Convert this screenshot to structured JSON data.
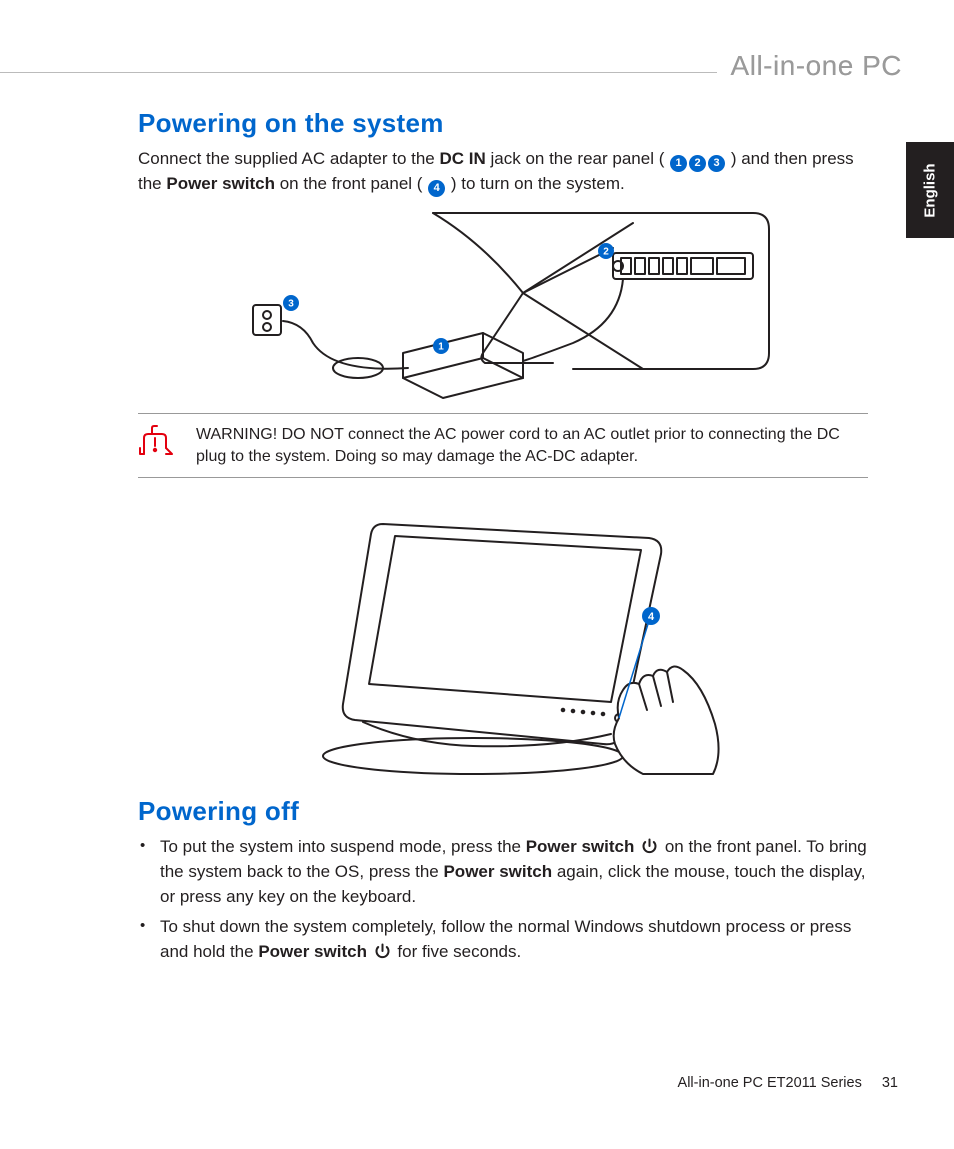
{
  "brand": "All-in-one PC",
  "language_tab": "English",
  "section1": {
    "heading": "Powering on the system",
    "para_pre": "Connect the supplied AC adapter to the ",
    "bold_dcin": "DC IN",
    "para_mid1": " jack on the rear panel ( ",
    "callouts_a": [
      "1",
      "2",
      "3"
    ],
    "para_mid2": " ) and then press the ",
    "bold_power": "Power switch",
    "para_mid3": " on the front panel ( ",
    "callouts_b": [
      "4"
    ],
    "para_end": " ) to turn on the system."
  },
  "figure1_callouts": {
    "c1": "1",
    "c2": "2",
    "c3": "3"
  },
  "figure2_callout": "4",
  "warning": {
    "text": "WARNING! DO NOT connect the AC power cord to an AC outlet prior to connecting the DC plug to the system. Doing so may damage the AC-DC adapter."
  },
  "section2": {
    "heading": "Powering off",
    "bullet1": {
      "a": "To put the system into suspend mode, press the ",
      "b": "Power switch",
      "c": " on the front panel. To bring the system back to the OS, press the ",
      "d": "Power switch",
      "e": " again, click the mouse, touch the display, or press any key on the keyboard."
    },
    "bullet2": {
      "a": "To shut down the system completely, follow the normal Windows shutdown process or press and hold the ",
      "b": "Power switch",
      "c": " for five seconds."
    }
  },
  "footer": {
    "series": "All-in-one PC ET2011 Series",
    "page": "31"
  }
}
